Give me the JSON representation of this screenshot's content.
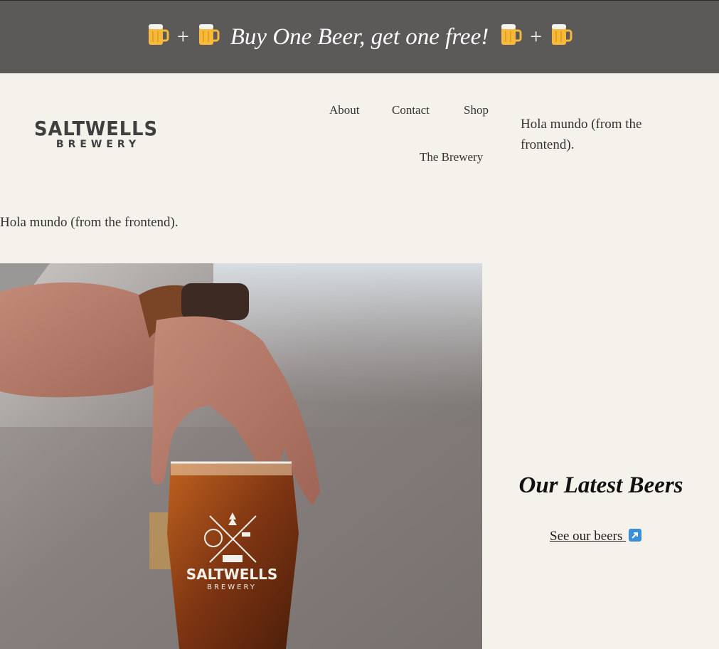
{
  "banner": {
    "plus_1": "+",
    "plus_2": "+",
    "promo_text": "Buy One Beer, get one free!",
    "icon": "beer-mug-icon"
  },
  "logo": {
    "line1": "SALTWELLS",
    "line2": "BREWERY"
  },
  "nav": {
    "about": "About",
    "contact": "Contact",
    "shop": "Shop",
    "brewery": "The Brewery"
  },
  "hola_right": "Hola mundo (from the frontend).",
  "hola_left": "Hola mundo (from the frontend).",
  "hero_image": {
    "glass_logo_line1": "SALTWELLS",
    "glass_logo_line2": "BREWERY"
  },
  "latest": {
    "title": "Our Latest Beers",
    "link": "See our beers",
    "link_icon": "external-arrow-icon"
  },
  "colors": {
    "banner_bg": "#5b5a58",
    "page_bg": "#f5f2ec",
    "link_icon": "#3a8fd6"
  }
}
